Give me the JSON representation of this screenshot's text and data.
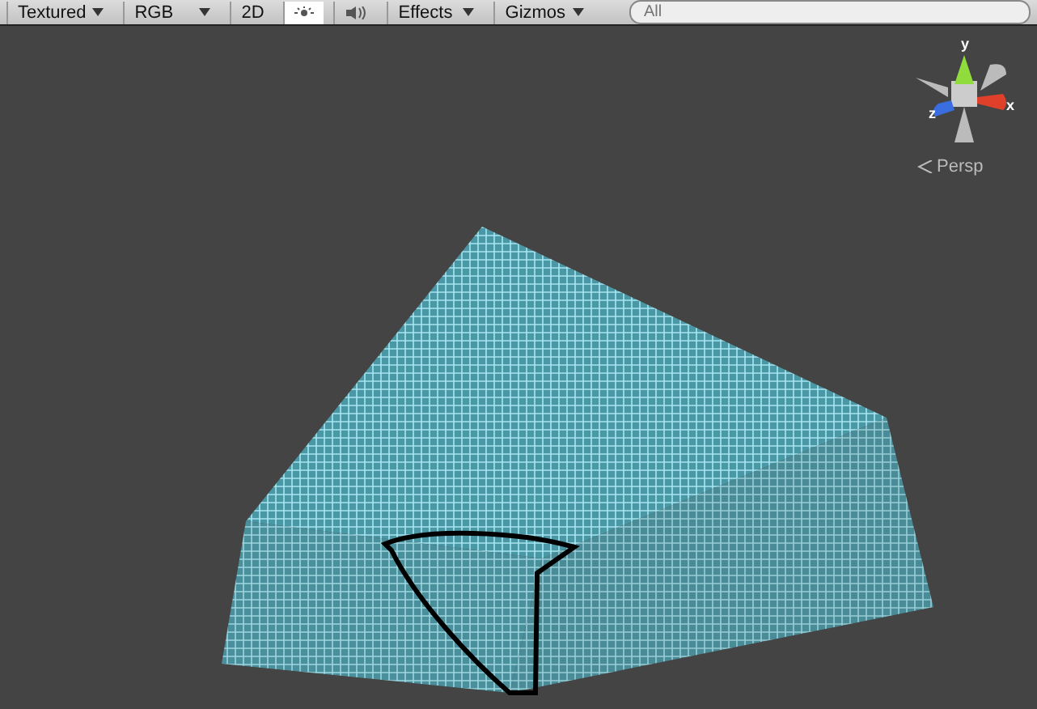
{
  "toolbar": {
    "items": [
      {
        "kind": "dropdown",
        "label": "Textured"
      },
      {
        "kind": "dropdown",
        "label": "RGB"
      },
      {
        "kind": "toggle",
        "label": "2D",
        "selected": false
      },
      {
        "kind": "lighting",
        "selected": true
      },
      {
        "kind": "audio",
        "selected": false
      },
      {
        "kind": "dropdown",
        "label": "Effects"
      },
      {
        "kind": "dropdown",
        "label": "Gizmos"
      }
    ],
    "search": {
      "placeholder": "All"
    }
  },
  "gizmo": {
    "axes": [
      {
        "label": "y",
        "color": "#8fdc3c"
      },
      {
        "label": "x",
        "color": "#e0402a"
      },
      {
        "label": "z",
        "color": "#3a6ee0"
      }
    ],
    "projection": "Persp"
  }
}
